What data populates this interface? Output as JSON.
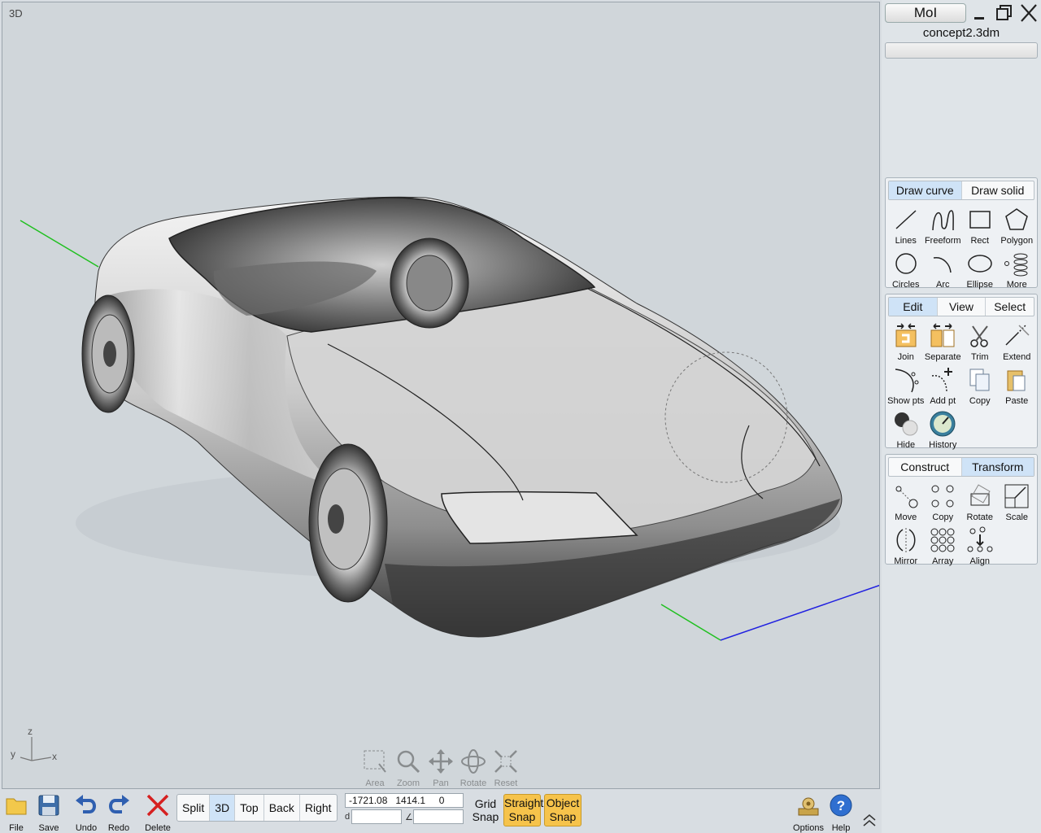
{
  "viewport": {
    "label": "3D",
    "axes": {
      "z": "z",
      "y": "y",
      "x": "x"
    }
  },
  "viewport_tools": [
    {
      "name": "area",
      "label": "Area",
      "icon": "area-zoom-icon"
    },
    {
      "name": "zoom",
      "label": "Zoom",
      "icon": "magnifier-icon"
    },
    {
      "name": "pan",
      "label": "Pan",
      "icon": "pan-arrows-icon"
    },
    {
      "name": "rotate",
      "label": "Rotate",
      "icon": "rotate-icon"
    },
    {
      "name": "reset",
      "label": "Reset",
      "icon": "reset-view-icon"
    }
  ],
  "app": {
    "button_label": "MoI",
    "file_name": "concept2.3dm"
  },
  "draw_palette": {
    "tabs": [
      "Draw curve",
      "Draw solid"
    ],
    "active_tab": "Draw curve",
    "tools": [
      "Lines",
      "Freeform",
      "Rect",
      "Polygon",
      "Circles",
      "Arc",
      "Ellipse",
      "More"
    ]
  },
  "edit_palette": {
    "tabs": [
      "Edit",
      "View",
      "Select"
    ],
    "active_tab": "Edit",
    "tools": [
      "Join",
      "Separate",
      "Trim",
      "Extend",
      "Show pts",
      "Add pt",
      "Copy",
      "Paste",
      "Hide",
      "History"
    ]
  },
  "transform_palette": {
    "tabs": [
      "Construct",
      "Transform"
    ],
    "active_tab": "Transform",
    "tools": [
      "Move",
      "Copy",
      "Rotate",
      "Scale",
      "Mirror",
      "Array",
      "Align"
    ]
  },
  "bottom_bar": {
    "file": "File",
    "save": "Save",
    "undo": "Undo",
    "redo": "Redo",
    "delete": "Delete",
    "views": [
      "Split",
      "3D",
      "Top",
      "Back",
      "Right"
    ],
    "active_view": "3D",
    "coordinates": "-1721.08   1414.1     0",
    "distance_tag": "d",
    "angle_tag": "∠",
    "grid_snap": [
      "Grid",
      "Snap"
    ],
    "straight_snap": [
      "Straight",
      "Snap"
    ],
    "object_snap": [
      "Object",
      "Snap"
    ],
    "options": "Options",
    "help": "Help"
  },
  "colors": {
    "accent_tab": "#cfe3f7",
    "snap_on": "#f6c34b",
    "axis_x": "#2020e0",
    "axis_y": "#20c020"
  }
}
